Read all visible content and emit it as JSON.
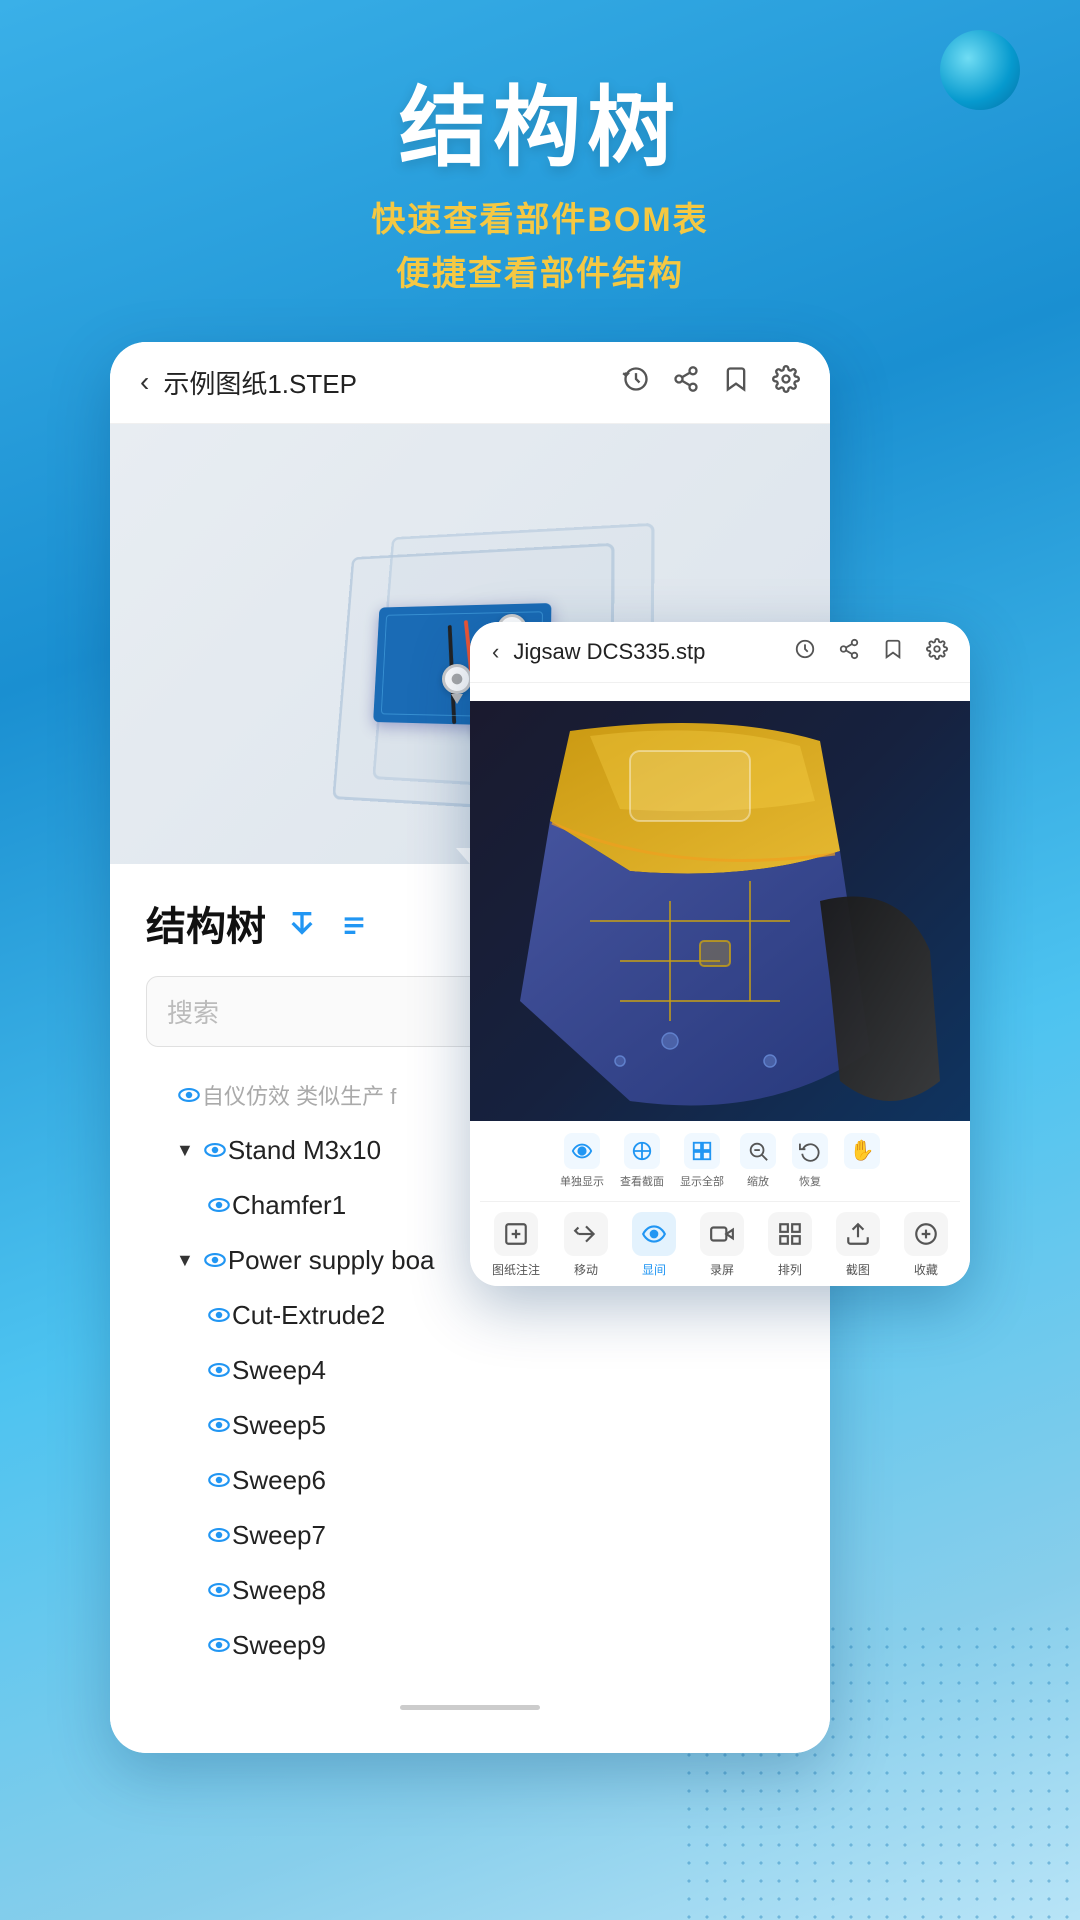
{
  "hero": {
    "title": "结构树",
    "subtitle_line1": "快速查看部件BOM表",
    "subtitle_line2": "便捷查看部件结构"
  },
  "primary_card": {
    "header": {
      "back_icon": "‹",
      "title": "示例图纸1.STEP",
      "icons": [
        "⏱",
        "⤴",
        "⊟",
        "⚙"
      ]
    },
    "tree": {
      "title": "结构树",
      "icon_expand": "⇅",
      "icon_list": "≡",
      "search_placeholder": "搜索",
      "items": [
        {
          "label": "自仪仿效 类似生产 f",
          "indent": 1,
          "has_eye": true,
          "truncated": true
        },
        {
          "label": "Stand M3x10",
          "indent": 1,
          "has_arrow": true,
          "has_eye": true
        },
        {
          "label": "Chamfer1",
          "indent": 2,
          "has_eye": true
        },
        {
          "label": "Power supply  boa",
          "indent": 1,
          "has_arrow": true,
          "has_eye": true,
          "truncated": true
        },
        {
          "label": "Cut-Extrude2",
          "indent": 2,
          "has_eye": true
        },
        {
          "label": "Sweep4",
          "indent": 2,
          "has_eye": true
        },
        {
          "label": "Sweep5",
          "indent": 2,
          "has_eye": true
        },
        {
          "label": "Sweep6",
          "indent": 2,
          "has_eye": true
        },
        {
          "label": "Sweep7",
          "indent": 2,
          "has_eye": true
        },
        {
          "label": "Sweep8",
          "indent": 2,
          "has_eye": true
        },
        {
          "label": "Sweep9",
          "indent": 2,
          "has_eye": true
        }
      ]
    }
  },
  "secondary_card": {
    "header": {
      "back_icon": "‹",
      "title": "Jigsaw DCS335.stp",
      "icons": [
        "⏱",
        "⤴",
        "⊟",
        "⚙"
      ]
    },
    "toolbar_top": [
      {
        "label": "单独显示",
        "icon": "◉"
      },
      {
        "label": "查看截面",
        "icon": "⊕"
      },
      {
        "label": "显示全部",
        "icon": "⊞"
      },
      {
        "label": "缩放",
        "icon": "⊙"
      },
      {
        "label": "恢复",
        "icon": "↩"
      },
      {
        "label": "",
        "icon": "✋"
      }
    ],
    "toolbar_bottom": [
      {
        "label": "图纸注注",
        "icon": "📷"
      },
      {
        "label": "移动",
        "icon": "↔"
      },
      {
        "label": "显间",
        "icon": "👁",
        "active": true
      },
      {
        "label": "录屏",
        "icon": "🎬"
      },
      {
        "label": "排列",
        "icon": "⊞"
      },
      {
        "label": "截图",
        "icon": "✂"
      },
      {
        "label": "收藏",
        "icon": "⊕"
      }
    ]
  }
}
